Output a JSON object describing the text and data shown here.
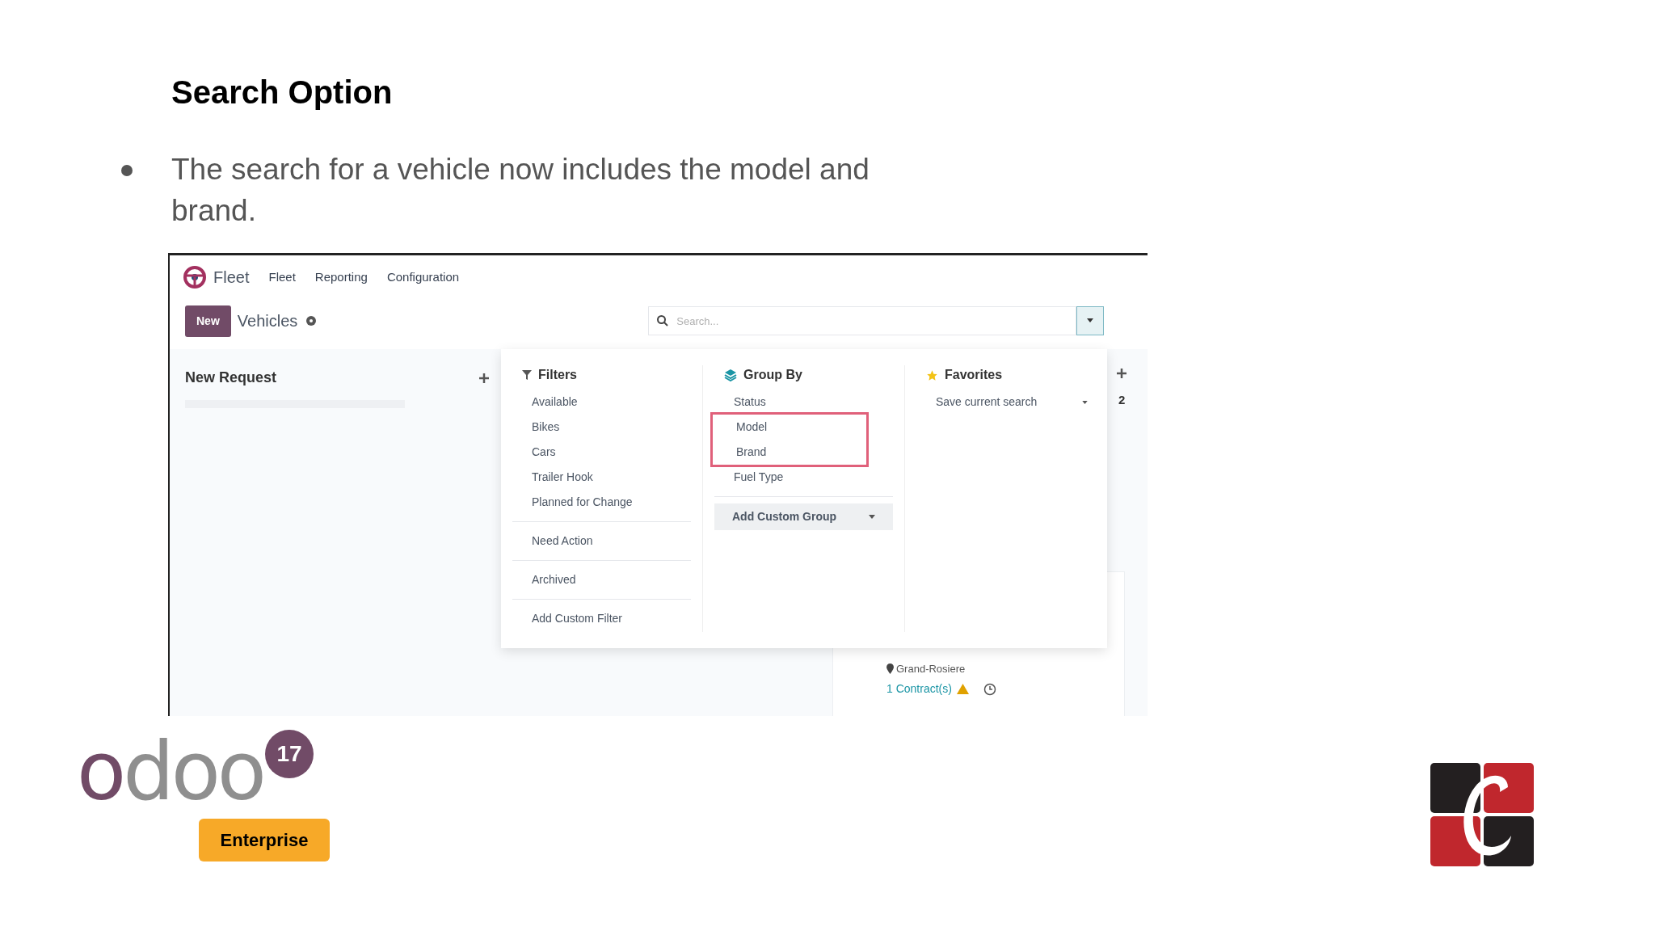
{
  "slide": {
    "title": "Search Option",
    "bullets": [
      "The search for a vehicle now includes the model and brand."
    ]
  },
  "app": {
    "nav": {
      "app_name": "Fleet",
      "menu": [
        "Fleet",
        "Reporting",
        "Configuration"
      ]
    },
    "control_panel": {
      "new_button": "New",
      "breadcrumb": "Vehicles",
      "search": {
        "placeholder": "Search..."
      }
    },
    "kanban": {
      "column_title": "New Request",
      "progress": {
        "level": 0
      },
      "next_column_count": "2",
      "card": {
        "location": "Grand-Rosiere",
        "contracts": "1 Contract(s)"
      }
    },
    "search_panel": {
      "filters": {
        "title": "Filters",
        "groups": [
          [
            "Available",
            "Bikes",
            "Cars",
            "Trailer Hook",
            "Planned for Change"
          ],
          [
            "Need Action"
          ],
          [
            "Archived"
          ]
        ],
        "add": "Add Custom Filter"
      },
      "group_by": {
        "title": "Group By",
        "items": [
          {
            "label": "Status",
            "highlighted": false
          },
          {
            "label": "Model",
            "highlighted": true
          },
          {
            "label": "Brand",
            "highlighted": true
          },
          {
            "label": "Fuel Type",
            "highlighted": false
          }
        ],
        "add": "Add Custom Group"
      },
      "favorites": {
        "title": "Favorites",
        "items": [
          "Save current search"
        ]
      }
    }
  },
  "branding": {
    "wordmark": "odoo",
    "version": "17",
    "edition": "Enterprise"
  }
}
